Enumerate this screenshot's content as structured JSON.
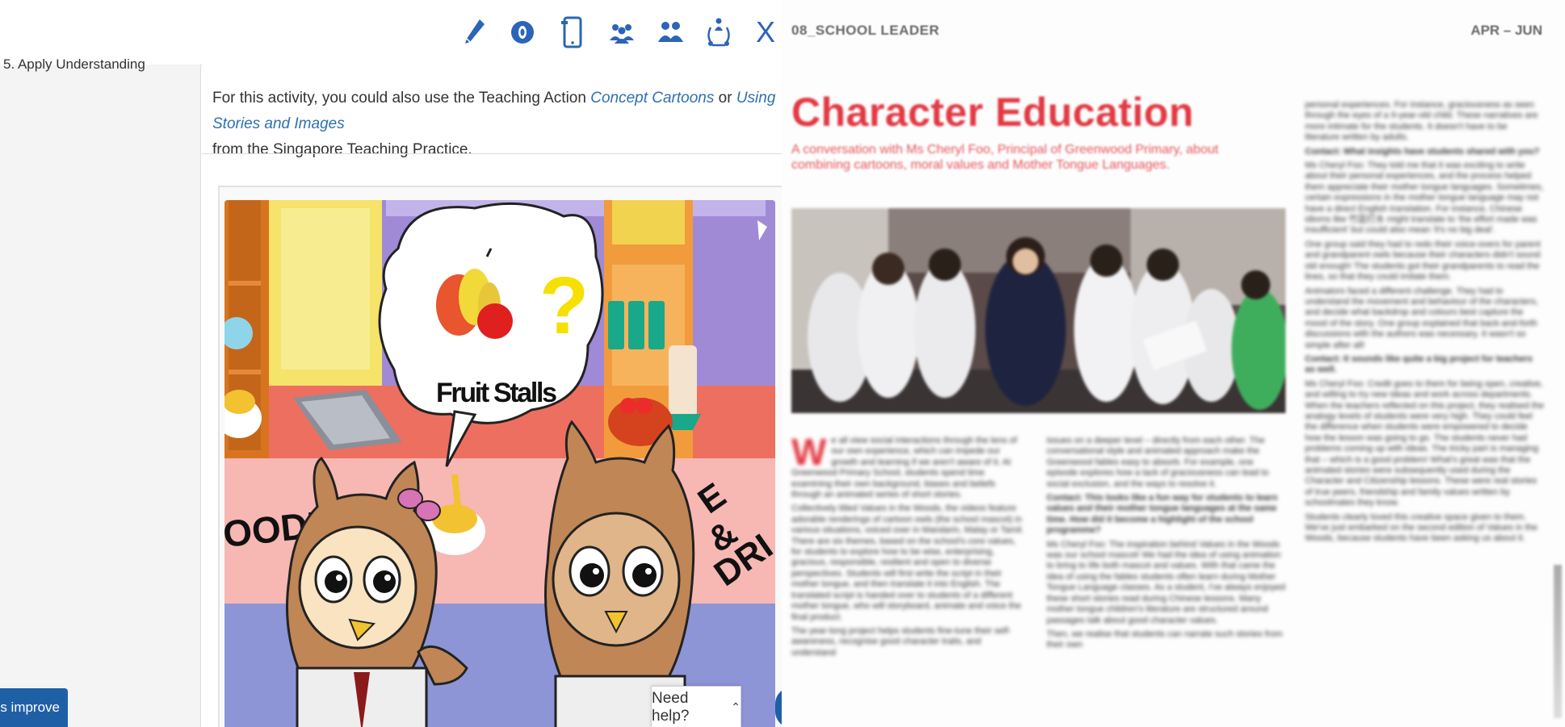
{
  "toolbar": {
    "icons": [
      "pencil-icon",
      "target-icon",
      "mobile-device-icon",
      "group-icon",
      "pair-icon",
      "network-person-icon",
      "close-icon"
    ],
    "close_label": "X"
  },
  "sidebar": {
    "item_label": "5. Apply Understanding"
  },
  "content": {
    "note_before": "For this activity, you could also use the Teaching Action ",
    "link1": "Concept Cartoons",
    "note_mid": " or ",
    "link2": "Using Stories and Images",
    "note_after": "from the Singapore Teaching Practice.",
    "illustration": {
      "bubble_text": "Fruit Stalls",
      "bubble_mark": "?",
      "left_sign": "OODLE",
      "right_sign_1": "E",
      "right_sign_2": "&",
      "right_sign_3": "DRI"
    }
  },
  "buttons": {
    "improve": "us improve",
    "help": "Need help?"
  },
  "magazine": {
    "header_left": "08_SCHOOL LEADER",
    "header_right": "APR – JUN",
    "title": "Character Education",
    "subtitle": "A conversation with Ms Cheryl Foo, Principal of Greenwood Primary, about combining cartoons, moral values and Mother Tongue Languages.",
    "col1": [
      "e all view social interactions through the lens of our own experience, which can impede our growth and learning if we aren't aware of it. At Greenwood Primary School, students spend time examining their own background, biases and beliefs through an animated series of short stories.",
      "Collectively titled Values in the Woods, the videos feature adorable renderings of cartoon owls (the school mascot) in various situations, voiced over in Mandarin, Malay or Tamil. There are six themes, based on the school's core values, for students to explore how to be wise, enterprising, gracious, responsible, resilient and open to diverse perspectives. Students will first write the script in their mother tongue, and then translate it into English. The translated script is handed over to students of a different mother tongue, who will storyboard, animate and voice the final product.",
      "The year-long project helps students fine-tune their self-awareness, recognise good character traits, and understand"
    ],
    "col2": [
      "issues on a deeper level – directly from each other. The conversational style and animated approach make the Greenwood fables easy to absorb. For example, one episode explores how a lack of graciousness can lead to social exclusion, and the ways to resolve it.",
      "Contact: This looks like a fun way for students to learn values and their mother tongue languages at the same time. How did it become a highlight of the school programme?",
      "Ms Cheryl Foo: The inspiration behind Values in the Woods was our school mascot! We had the idea of using animation to bring to life both mascot and values. With that came the idea of using the fables students often learn during Mother Tongue Language classes. As a student, I've always enjoyed these short stories read during Chinese lessons. Many mother tongue children's literature are structured around passages talk about good character values.",
      "Then, we realise that students can narrate such stories from their own"
    ],
    "col3": [
      "personal experiences. For instance, graciousness as seen through the eyes of a 9-year-old child. These narratives are more intimate for the students. It doesn't have to be literature written by adults.",
      "Contact: What insights have students shared with you?",
      "Ms Cheryl Foo: They told me that it was exciting to write about their personal experiences, and the process helped them appreciate their mother tongue languages. Sometimes, certain expressions in the mother tongue language may not have a direct English translation. For instance, Chinese idioms like 竹篮打水 might translate to 'the effort made was insufficient' but could also mean 'it's no big deal'.",
      "One group said they had to redo their voice-overs for parent and grandparent owls because their characters didn't sound old enough! The students got their grandparents to read the lines, so that they could imitate them.",
      "Animators faced a different challenge. They had to understand the movement and behaviour of the characters, and decide what backdrop and colours best capture the mood of the story. One group explained that back-and-forth discussions with the authors was necessary. It wasn't so simple after all!",
      "Contact: It sounds like quite a big project for teachers as well.",
      "Ms Cheryl Foo: Credit goes to them for being open, creative, and willing to try new ideas and work across departments. When the teachers reflected on this project, they realised the analogy levels of students were very high. They could feel the difference when students were empowered to decide how the lesson was going to go. The students never had problems coming up with ideas. The tricky part is managing that – which is a good problem! What's great was that the animated stories were subsequently used during the Character and Citizenship lessons. These were real stories of true peers, friendship and family values written by schoolmates they know.",
      "Students clearly loved this creative space given to them. We've just embarked on the second edition of Values in the Woods, because students have been asking us about it."
    ]
  }
}
